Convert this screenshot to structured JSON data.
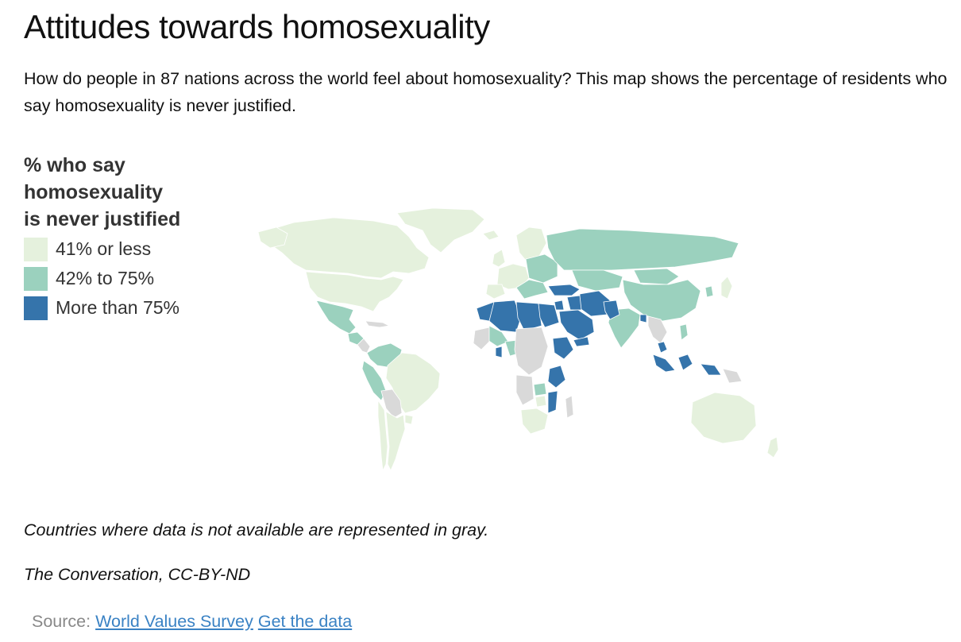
{
  "title": "Attitudes towards homosexuality",
  "subtitle": "How do people in 87 nations across the world feel about homosexuality? This map shows the percentage of residents who say homosexuality is never justified.",
  "legend": {
    "title_line1": "% who say",
    "title_line2": "homosexuality",
    "title_line3": "is never justified",
    "items": [
      {
        "label": "41% or less",
        "color": "#e5f1dd"
      },
      {
        "label": "42% to 75%",
        "color": "#9bd1be"
      },
      {
        "label": "More than 75%",
        "color": "#3574ab"
      }
    ],
    "no_data_color": "#d9d9d9"
  },
  "map_categories": {
    "low": [
      "United States",
      "Canada",
      "Greenland",
      "Brazil",
      "Argentina",
      "Chile",
      "Uruguay",
      "Australia",
      "New Zealand",
      "Western Europe",
      "South Africa",
      "Zimbabwe",
      "Japan"
    ],
    "mid": [
      "Russia",
      "China",
      "Mexico",
      "Colombia",
      "Peru",
      "Ecuador",
      "Venezuela",
      "Guatemala",
      "Nigeria",
      "India",
      "Kazakhstan",
      "Mongolia",
      "Eastern Europe",
      "Zambia",
      "Mali",
      "South Korea",
      "Philippines"
    ],
    "high": [
      "Morocco",
      "Algeria",
      "Libya",
      "Egypt",
      "Saudi Arabia",
      "Iran",
      "Pakistan",
      "Turkey",
      "Ethiopia",
      "Tanzania",
      "Indonesia",
      "Malaysia",
      "Bangladesh",
      "Yemen",
      "Jordan",
      "Iraq",
      "Ghana",
      "Mozambique"
    ]
  },
  "notes": {
    "no_data": "Countries where data is not available are represented in gray.",
    "credit": "The Conversation, CC-BY-ND"
  },
  "source": {
    "prefix": "Source:",
    "link1": "World Values Survey",
    "link2": "Get the data"
  }
}
